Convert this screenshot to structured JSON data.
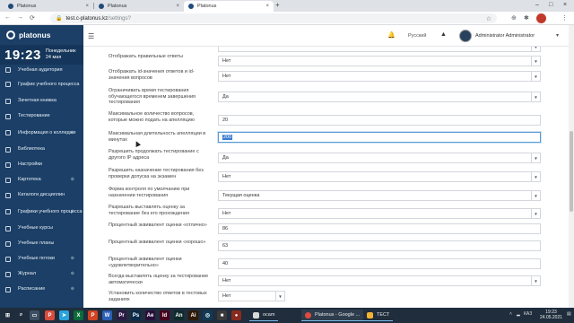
{
  "browser": {
    "tabs": [
      {
        "title": "Platonus",
        "active": false
      },
      {
        "title": "Platonus",
        "active": false
      },
      {
        "title": "Platonus",
        "active": true
      }
    ],
    "url_host": "test.c-platonus.kz",
    "url_path": "/settings?",
    "new_tab_glyph": "+"
  },
  "app": {
    "logo": "platonus",
    "clock": {
      "time": "19:23",
      "weekday": "Понедельник",
      "date": "24 мая"
    },
    "header": {
      "language": "Русский",
      "user": "Administrator Administrator"
    },
    "sidebar": {
      "items": [
        {
          "label": "Учебная аудитория",
          "icon": "classroom-icon",
          "expandable": false
        },
        {
          "label": "График учебного процесса",
          "icon": "calendar-icon",
          "expandable": false
        },
        {
          "label": "Зачетная книжка",
          "icon": "gradebook-icon",
          "expandable": false
        },
        {
          "label": "Тестирование",
          "icon": "testing-icon",
          "expandable": false
        },
        {
          "label": "Информация о колледже",
          "icon": "info-icon",
          "expandable": true
        },
        {
          "label": "Библиотека",
          "icon": "library-icon",
          "expandable": false
        },
        {
          "label": "Настройки",
          "icon": "gear-icon",
          "expandable": false
        },
        {
          "label": "Картотека",
          "icon": "card-index-icon",
          "expandable": true
        },
        {
          "label": "Каталоги дисциплин",
          "icon": "catalog-icon",
          "expandable": false
        },
        {
          "label": "Графики учебного процесса",
          "icon": "schedule-icon",
          "expandable": true
        },
        {
          "label": "Учебные курсы",
          "icon": "courses-icon",
          "expandable": false
        },
        {
          "label": "Учебные планы",
          "icon": "plans-icon",
          "expandable": false
        },
        {
          "label": "Учебные потоки",
          "icon": "streams-icon",
          "expandable": true
        },
        {
          "label": "Журнал",
          "icon": "journal-icon",
          "expandable": true
        },
        {
          "label": "Расписание",
          "icon": "timetable-icon",
          "expandable": true
        }
      ]
    }
  },
  "settings": [
    {
      "label": "",
      "value": "",
      "type": "select"
    },
    {
      "label": "Отображать правильные ответы",
      "value": "Нет",
      "type": "select"
    },
    {
      "label": "Отображать id-значения ответов и id-значения вопросов",
      "value": "Нет",
      "type": "select"
    },
    {
      "label": "Ограничивать время тестирования обучающегося временем завершения тестирования",
      "value": "Да",
      "type": "select"
    },
    {
      "label": "Максимальное количество вопросов, которые можно подать на апелляцию",
      "value": "20",
      "type": "input"
    },
    {
      "label": "Максимальная длительность апелляции в минутах",
      "value": "200",
      "type": "input-focused"
    },
    {
      "label": "Разрешить продолжать тестирование с другого IP адреса",
      "value": "Да",
      "type": "select"
    },
    {
      "label": "Разрешить назначение тестирования без проверки допуска на экзамен",
      "value": "Нет",
      "type": "select"
    },
    {
      "label": "Форма контроля по умолчанию при назначении тестирования",
      "value": "Текущая оценка",
      "type": "select"
    },
    {
      "label": "Разрешать выставлять оценку за тестирование без его прохождения",
      "value": "Нет",
      "type": "select"
    },
    {
      "label": "Процентный эквивалент оценки «отлично»",
      "value": "86",
      "type": "input"
    },
    {
      "label": "Процентный эквивалент оценки «хорошо»",
      "value": "63",
      "type": "input"
    },
    {
      "label": "Процентный эквивалент оценки «удовлетворительно»",
      "value": "40",
      "type": "input"
    },
    {
      "label": "Всегда выставлять оценку за тестирование автоматически",
      "value": "Нет",
      "type": "select"
    },
    {
      "label": "Установить количество ответов в тестовых заданиях",
      "value": "Нет",
      "type": "select-short"
    }
  ],
  "taskbar": {
    "apps": [
      {
        "label": "ocam",
        "color": "#d9d9d9"
      },
      {
        "label": "Platonus - Google ...",
        "color": "#e04a3f"
      },
      {
        "label": "ТЕСТ",
        "color": "#f2b233"
      }
    ],
    "tray_lang": "КАЗ",
    "time": "19:23",
    "date": "24.05.2021"
  }
}
